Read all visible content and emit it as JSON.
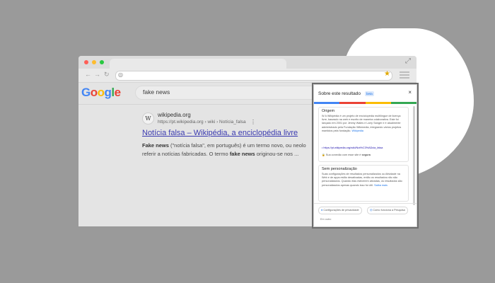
{
  "search": {
    "query": "fake news"
  },
  "logo": {
    "letters": [
      {
        "ch": "G",
        "color": "#4285F4"
      },
      {
        "ch": "o",
        "color": "#EA4335"
      },
      {
        "ch": "o",
        "color": "#FBBC05"
      },
      {
        "ch": "g",
        "color": "#4285F4"
      },
      {
        "ch": "l",
        "color": "#34A853"
      },
      {
        "ch": "e",
        "color": "#EA4335"
      }
    ]
  },
  "result": {
    "site_name": "wikipedia.org",
    "url_crumb": "https://pt.wikipedia.org › wiki › Notícia_falsa",
    "title": "Notícia falsa – Wikipédia, a enciclopédia livre",
    "snippet_1_bold": "Fake news",
    "snippet_1_rest": " (\"notícia falsa\", em português) é um termo novo, ou neolo",
    "snippet_2_a": "referir a notícias fabricadas. O termo ",
    "snippet_2_bold": "fake news",
    "snippet_2_rest": " originou-se nos ..."
  },
  "panel": {
    "title": "Sobre este resultado",
    "beta": "beta",
    "close": "×",
    "source": {
      "heading": "Origem",
      "text": "A Wikipédia é um projeto de enciclopédia multilíngue de licença livre, baseado na web e escrito de maneira colaborativa. Este foi lançado em 2001 por Jimmy Wales e Larry Sanger e é atualmente administrado pela Fundação Wikimedia, integrando vários projetos mantidos pela fundação.",
      "link": "Wikipedia",
      "url": "https://pt.wikipedia.org/wiki/Not%C3%ADcia_falsa",
      "secure_text_a": "Sua conexão com esse site é ",
      "secure_text_b": "segura"
    },
    "personal": {
      "heading": "Sem personalização",
      "text": "Suas configurações de resultados personalizados ou Atividade na Web e de apps estão desativadas, então os resultados não são personalizados. Quando elas estiverem ativadas, os resultados são personalizados apenas quando isso for útil.",
      "link": "Saiba mais"
    },
    "btn_privacy": "Configurações de privacidade",
    "btn_how": "Como funciona a Pesquisa",
    "feedback": "Em outro"
  },
  "colors": {
    "link": "#3a3ab0",
    "close_dot": "#ff5f57",
    "min_dot": "#febc2e",
    "max_dot": "#28c840"
  }
}
